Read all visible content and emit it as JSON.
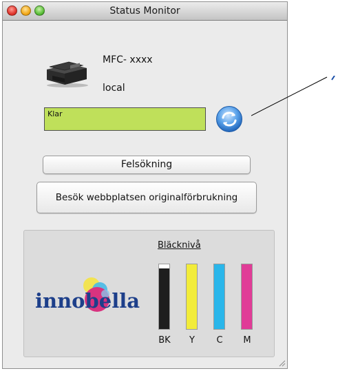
{
  "window": {
    "title": "Status Monitor"
  },
  "device": {
    "model": "MFC- xxxx",
    "location": "local"
  },
  "status": {
    "text": "Klar",
    "color": "#bfe05a"
  },
  "buttons": {
    "troubleshoot": "Felsökning",
    "supplies_site": "Besök webbplatsen originalförbrukning"
  },
  "ink": {
    "label": "Bläcknivå",
    "cartridges": [
      {
        "name": "BK",
        "level": 0.94,
        "color": "#1e1e1e"
      },
      {
        "name": "Y",
        "level": 1.0,
        "color": "#f2ec3a"
      },
      {
        "name": "C",
        "level": 1.0,
        "color": "#2ab6ea"
      },
      {
        "name": "M",
        "level": 1.0,
        "color": "#e03c97"
      }
    ]
  },
  "brand": {
    "logo_text": "innobella"
  },
  "icons": {
    "printer": "printer-icon",
    "refresh": "refresh-icon",
    "logo": "innobella-logo"
  }
}
